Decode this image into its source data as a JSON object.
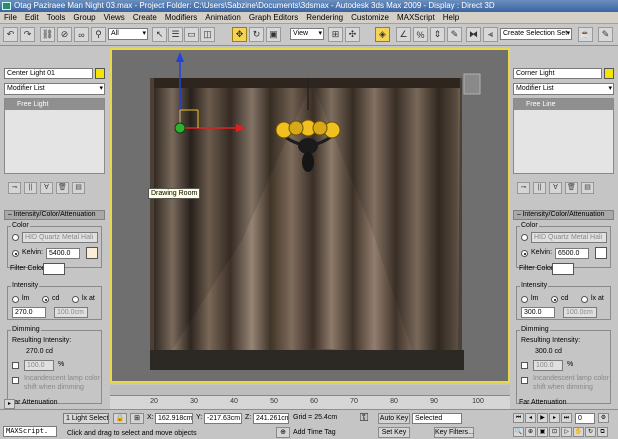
{
  "title": "Otag Paziraee Man Night 03.max    -  Project Folder: C:\\Users\\Sabzine\\Documents\\3dsmax   -  Autodesk 3ds Max  2009      -  Display : Direct 3D",
  "menu": [
    "File",
    "Edit",
    "Tools",
    "Group",
    "Views",
    "Create",
    "Modifiers",
    "Animation",
    "Graph Editors",
    "Rendering",
    "Customize",
    "MAXScript",
    "Help"
  ],
  "toolbar": {
    "filter": "All",
    "view_mode": "View",
    "selection_set": "Create Selection Set"
  },
  "viewport": {
    "label": "Drawing Room",
    "colors": {
      "border": "#e8d84a",
      "background": "#6f6f6f",
      "gizmo_x": "#e02020",
      "gizmo_y": "#2040e0",
      "light": "#f0c020"
    }
  },
  "left_panel": {
    "object_name": "Center Light 01",
    "swatch_color": "#f5e300",
    "modifier_list": "Modifier List",
    "stack_item": "Free Light",
    "rollout": "Intensity/Color/Attenuation",
    "color_label": "Color",
    "preset": "HID Quartz Metal Hali",
    "kelvin_label": "Kelvin:",
    "kelvin_value": "5400.0",
    "filter_color_label": "Filter Color:",
    "intensity_label": "Intensity",
    "units": [
      "lm",
      "cd",
      "lx at"
    ],
    "intensity_value": "270.0",
    "distance_value": "100.0cm",
    "dimming_label": "Dimming",
    "resulting_label": "Resulting Intensity:",
    "resulting_value": "270.0 cd",
    "dim_pct": "100.0",
    "pct_sign": "%",
    "incandescent_1": "Incandescent lamp color",
    "incandescent_2": "shift when dimming",
    "far_atten": "Far Attenuation"
  },
  "right_panel": {
    "object_name": "Corner Light",
    "swatch_color": "#f5e300",
    "modifier_list": "Modifier List",
    "stack_item": "Free Line",
    "rollout": "Intensity/Color/Attenuation",
    "color_label": "Color",
    "preset": "HID Quartz Metal Hali",
    "kelvin_label": "Kelvin:",
    "kelvin_value": "6500.0",
    "filter_color_label": "Filter Color:",
    "intensity_label": "Intensity",
    "units": [
      "lm",
      "cd",
      "lx at"
    ],
    "intensity_value": "300.0",
    "distance_value": "100.0cm",
    "dimming_label": "Dimming",
    "resulting_label": "Resulting Intensity:",
    "resulting_value": "300.0 cd",
    "dim_pct": "100.0",
    "pct_sign": "%",
    "incandescent_1": "Incandescent lamp color",
    "incandescent_2": "shift when dimming",
    "far_atten": "Far Attenuation"
  },
  "ruler_ticks": [
    "20",
    "30",
    "40",
    "50",
    "60",
    "70",
    "80",
    "90",
    "100"
  ],
  "status": {
    "script_label": "MAXScript.",
    "selected_count": "1 Light Select",
    "x_label": "X:",
    "x_value": "162.918cm",
    "y_label": "Y:",
    "y_value": "-217.63cm",
    "z_label": "Z:",
    "z_value": "241.261cm",
    "grid": "Grid = 25.4cm",
    "prompt": "Click and drag to select and move objects",
    "add_time_tag": "Add Time Tag",
    "auto_key": "Auto Key",
    "auto_key_value": "Selected",
    "set_key": "Set Key",
    "key_filters": "Key Filters...",
    "frame": "0"
  }
}
